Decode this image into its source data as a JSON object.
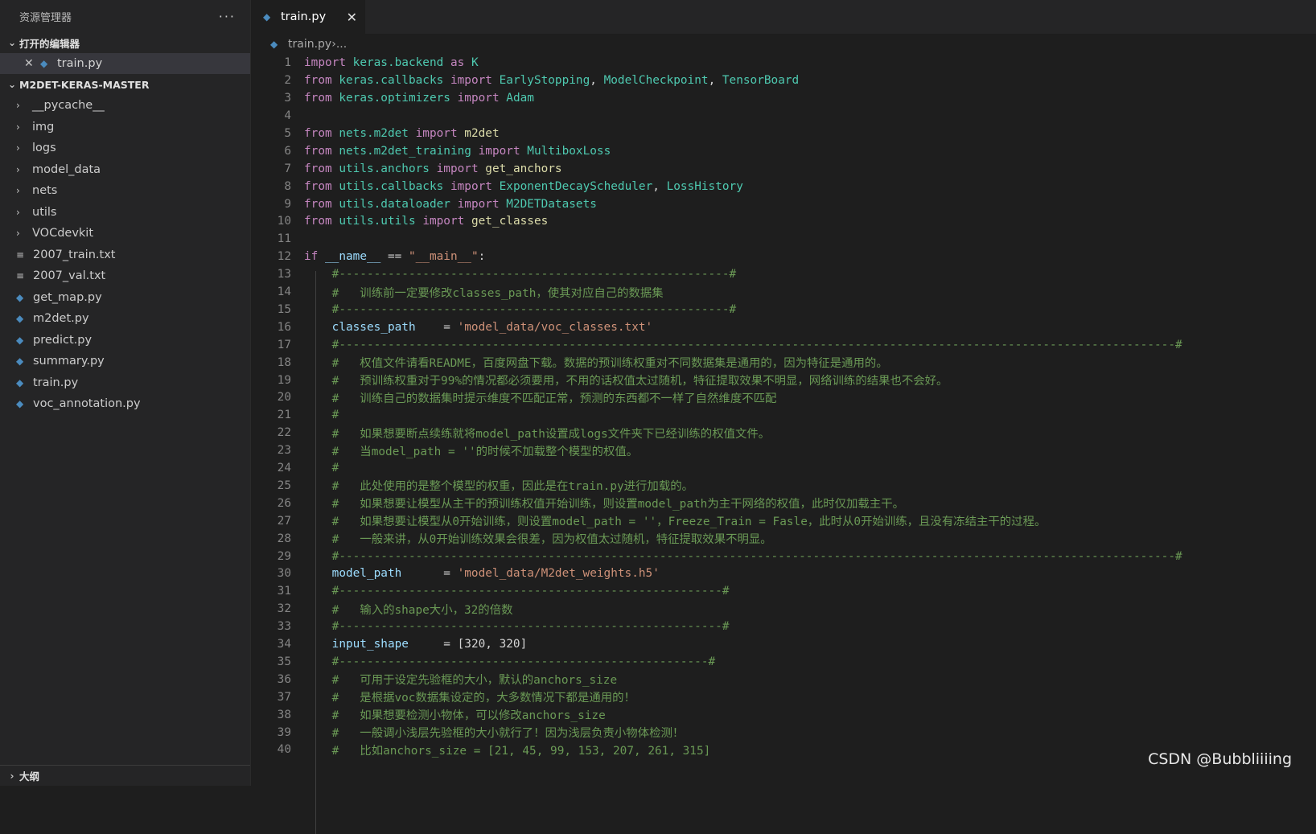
{
  "sidebar": {
    "title": "资源管理器",
    "more": "···",
    "open_editors_label": "打开的编辑器",
    "open_file": "train.py",
    "project_label": "M2DET-KERAS-MASTER",
    "items": [
      {
        "label": "__pycache__",
        "type": "folder"
      },
      {
        "label": "img",
        "type": "folder"
      },
      {
        "label": "logs",
        "type": "folder"
      },
      {
        "label": "model_data",
        "type": "folder"
      },
      {
        "label": "nets",
        "type": "folder"
      },
      {
        "label": "utils",
        "type": "folder"
      },
      {
        "label": "VOCdevkit",
        "type": "folder"
      },
      {
        "label": "2007_train.txt",
        "type": "txt"
      },
      {
        "label": "2007_val.txt",
        "type": "txt"
      },
      {
        "label": "get_map.py",
        "type": "py"
      },
      {
        "label": "m2det.py",
        "type": "py"
      },
      {
        "label": "predict.py",
        "type": "py"
      },
      {
        "label": "summary.py",
        "type": "py"
      },
      {
        "label": "train.py",
        "type": "py"
      },
      {
        "label": "voc_annotation.py",
        "type": "py"
      }
    ],
    "outline_label": "大纲"
  },
  "tab": {
    "label": "train.py"
  },
  "breadcrumb": {
    "file": "train.py",
    "sep": " › ",
    "rest": "..."
  },
  "editor": {
    "lines": [
      [
        [
          "kw",
          "import"
        ],
        [
          "plain",
          " "
        ],
        [
          "mod",
          "keras.backend"
        ],
        [
          "plain",
          " "
        ],
        [
          "kw",
          "as"
        ],
        [
          "plain",
          " "
        ],
        [
          "mod",
          "K"
        ]
      ],
      [
        [
          "kw",
          "from"
        ],
        [
          "plain",
          " "
        ],
        [
          "mod",
          "keras.callbacks"
        ],
        [
          "plain",
          " "
        ],
        [
          "kw",
          "import"
        ],
        [
          "plain",
          " "
        ],
        [
          "mod",
          "EarlyStopping"
        ],
        [
          "plain",
          ", "
        ],
        [
          "mod",
          "ModelCheckpoint"
        ],
        [
          "plain",
          ", "
        ],
        [
          "mod",
          "TensorBoard"
        ]
      ],
      [
        [
          "kw",
          "from"
        ],
        [
          "plain",
          " "
        ],
        [
          "mod",
          "keras.optimizers"
        ],
        [
          "plain",
          " "
        ],
        [
          "kw",
          "import"
        ],
        [
          "plain",
          " "
        ],
        [
          "mod",
          "Adam"
        ]
      ],
      [],
      [
        [
          "kw",
          "from"
        ],
        [
          "plain",
          " "
        ],
        [
          "mod",
          "nets.m2det"
        ],
        [
          "plain",
          " "
        ],
        [
          "kw",
          "import"
        ],
        [
          "plain",
          " "
        ],
        [
          "fn",
          "m2det"
        ]
      ],
      [
        [
          "kw",
          "from"
        ],
        [
          "plain",
          " "
        ],
        [
          "mod",
          "nets.m2det_training"
        ],
        [
          "plain",
          " "
        ],
        [
          "kw",
          "import"
        ],
        [
          "plain",
          " "
        ],
        [
          "mod",
          "MultiboxLoss"
        ]
      ],
      [
        [
          "kw",
          "from"
        ],
        [
          "plain",
          " "
        ],
        [
          "mod",
          "utils.anchors"
        ],
        [
          "plain",
          " "
        ],
        [
          "kw",
          "import"
        ],
        [
          "plain",
          " "
        ],
        [
          "fn",
          "get_anchors"
        ]
      ],
      [
        [
          "kw",
          "from"
        ],
        [
          "plain",
          " "
        ],
        [
          "mod",
          "utils.callbacks"
        ],
        [
          "plain",
          " "
        ],
        [
          "kw",
          "import"
        ],
        [
          "plain",
          " "
        ],
        [
          "mod",
          "ExponentDecayScheduler"
        ],
        [
          "plain",
          ", "
        ],
        [
          "mod",
          "LossHistory"
        ]
      ],
      [
        [
          "kw",
          "from"
        ],
        [
          "plain",
          " "
        ],
        [
          "mod",
          "utils.dataloader"
        ],
        [
          "plain",
          " "
        ],
        [
          "kw",
          "import"
        ],
        [
          "plain",
          " "
        ],
        [
          "mod",
          "M2DETDatasets"
        ]
      ],
      [
        [
          "kw",
          "from"
        ],
        [
          "plain",
          " "
        ],
        [
          "mod",
          "utils.utils"
        ],
        [
          "plain",
          " "
        ],
        [
          "kw",
          "import"
        ],
        [
          "plain",
          " "
        ],
        [
          "fn",
          "get_classes"
        ]
      ],
      [],
      [
        [
          "kw",
          "if"
        ],
        [
          "plain",
          " "
        ],
        [
          "var",
          "__name__"
        ],
        [
          "plain",
          " == "
        ],
        [
          "str",
          "\"__main__\""
        ],
        [
          "plain",
          ":"
        ]
      ],
      [
        [
          "plain",
          "    "
        ],
        [
          "cmt",
          "#--------------------------------------------------------#"
        ]
      ],
      [
        [
          "plain",
          "    "
        ],
        [
          "cmt",
          "#   训练前一定要修改classes_path，使其对应自己的数据集"
        ]
      ],
      [
        [
          "plain",
          "    "
        ],
        [
          "cmt",
          "#--------------------------------------------------------#"
        ]
      ],
      [
        [
          "plain",
          "    "
        ],
        [
          "var",
          "classes_path"
        ],
        [
          "plain",
          "    = "
        ],
        [
          "str",
          "'model_data/voc_classes.txt'"
        ]
      ],
      [
        [
          "plain",
          "    "
        ],
        [
          "cmt",
          "#------------------------------------------------------------------------------------------------------------------------#"
        ]
      ],
      [
        [
          "plain",
          "    "
        ],
        [
          "cmt",
          "#   权值文件请看README，百度网盘下载。数据的预训练权重对不同数据集是通用的，因为特征是通用的。"
        ]
      ],
      [
        [
          "plain",
          "    "
        ],
        [
          "cmt",
          "#   预训练权重对于99%的情况都必须要用，不用的话权值太过随机，特征提取效果不明显，网络训练的结果也不会好。"
        ]
      ],
      [
        [
          "plain",
          "    "
        ],
        [
          "cmt",
          "#   训练自己的数据集时提示维度不匹配正常，预测的东西都不一样了自然维度不匹配"
        ]
      ],
      [
        [
          "plain",
          "    "
        ],
        [
          "cmt",
          "#"
        ]
      ],
      [
        [
          "plain",
          "    "
        ],
        [
          "cmt",
          "#   如果想要断点续练就将model_path设置成logs文件夹下已经训练的权值文件。"
        ]
      ],
      [
        [
          "plain",
          "    "
        ],
        [
          "cmt",
          "#   当model_path = ''的时候不加载整个模型的权值。"
        ]
      ],
      [
        [
          "plain",
          "    "
        ],
        [
          "cmt",
          "#"
        ]
      ],
      [
        [
          "plain",
          "    "
        ],
        [
          "cmt",
          "#   此处使用的是整个模型的权重，因此是在train.py进行加载的。"
        ]
      ],
      [
        [
          "plain",
          "    "
        ],
        [
          "cmt",
          "#   如果想要让模型从主干的预训练权值开始训练，则设置model_path为主干网络的权值，此时仅加载主干。"
        ]
      ],
      [
        [
          "plain",
          "    "
        ],
        [
          "cmt",
          "#   如果想要让模型从0开始训练，则设置model_path = ''，Freeze_Train = Fasle，此时从0开始训练，且没有冻结主干的过程。"
        ]
      ],
      [
        [
          "plain",
          "    "
        ],
        [
          "cmt",
          "#   一般来讲，从0开始训练效果会很差，因为权值太过随机，特征提取效果不明显。"
        ]
      ],
      [
        [
          "plain",
          "    "
        ],
        [
          "cmt",
          "#------------------------------------------------------------------------------------------------------------------------#"
        ]
      ],
      [
        [
          "plain",
          "    "
        ],
        [
          "var",
          "model_path"
        ],
        [
          "plain",
          "      = "
        ],
        [
          "str",
          "'model_data/M2det_weights.h5'"
        ]
      ],
      [
        [
          "plain",
          "    "
        ],
        [
          "cmt",
          "#-------------------------------------------------------#"
        ]
      ],
      [
        [
          "plain",
          "    "
        ],
        [
          "cmt",
          "#   输入的shape大小，32的倍数"
        ]
      ],
      [
        [
          "plain",
          "    "
        ],
        [
          "cmt",
          "#-------------------------------------------------------#"
        ]
      ],
      [
        [
          "plain",
          "    "
        ],
        [
          "var",
          "input_shape"
        ],
        [
          "plain",
          "     = [320, 320]"
        ]
      ],
      [
        [
          "plain",
          "    "
        ],
        [
          "cmt",
          "#-----------------------------------------------------#"
        ]
      ],
      [
        [
          "plain",
          "    "
        ],
        [
          "cmt",
          "#   可用于设定先验框的大小，默认的anchors_size"
        ]
      ],
      [
        [
          "plain",
          "    "
        ],
        [
          "cmt",
          "#   是根据voc数据集设定的，大多数情况下都是通用的！"
        ]
      ],
      [
        [
          "plain",
          "    "
        ],
        [
          "cmt",
          "#   如果想要检测小物体，可以修改anchors_size"
        ]
      ],
      [
        [
          "plain",
          "    "
        ],
        [
          "cmt",
          "#   一般调小浅层先验框的大小就行了！因为浅层负责小物体检测！"
        ]
      ],
      [
        [
          "plain",
          "    "
        ],
        [
          "cmt",
          "#   比如anchors_size = [21, 45, 99, 153, 207, 261, 315]"
        ]
      ]
    ]
  },
  "watermark": "CSDN @Bubbliiiing"
}
